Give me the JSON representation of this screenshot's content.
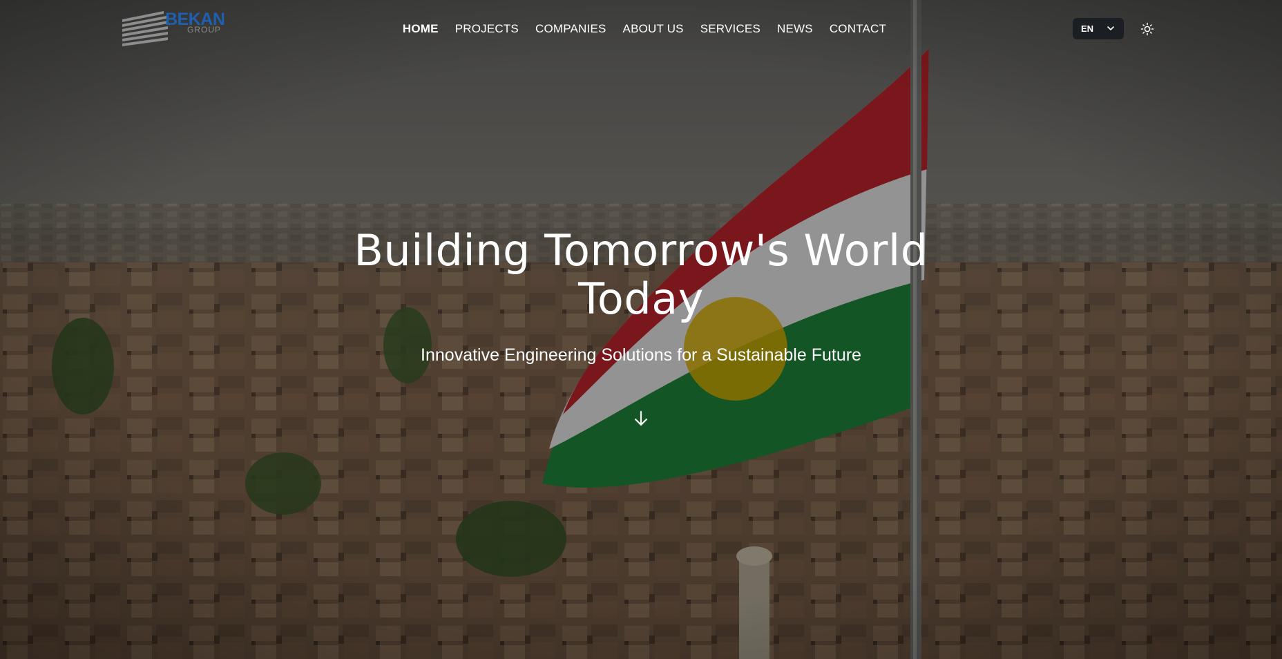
{
  "brand": {
    "name": "BEKAN",
    "sub": "GROUP",
    "primary_color": "#1e5fb0",
    "secondary_color": "#8a8a8a"
  },
  "nav": {
    "items": [
      {
        "label": "HOME",
        "active": true
      },
      {
        "label": "PROJECTS",
        "active": false
      },
      {
        "label": "COMPANIES",
        "active": false
      },
      {
        "label": "ABOUT US",
        "active": false
      },
      {
        "label": "SERVICES",
        "active": false
      },
      {
        "label": "NEWS",
        "active": false
      },
      {
        "label": "CONTACT",
        "active": false
      }
    ]
  },
  "language": {
    "selected": "EN",
    "icon": "chevron-down-icon"
  },
  "theme_toggle": {
    "icon": "sun-icon"
  },
  "hero": {
    "title_line1": "Building Tomorrow's World",
    "title_line2": "Today",
    "subtitle": "Innovative Engineering Solutions for a Sustainable Future",
    "scroll_icon": "arrow-down-icon",
    "background": "aerial-city-with-kurdistan-flag",
    "flag_colors": {
      "red": "#c4262e",
      "white": "#f2f2f2",
      "green": "#1f8a3a",
      "sun": "#f2c200"
    }
  }
}
